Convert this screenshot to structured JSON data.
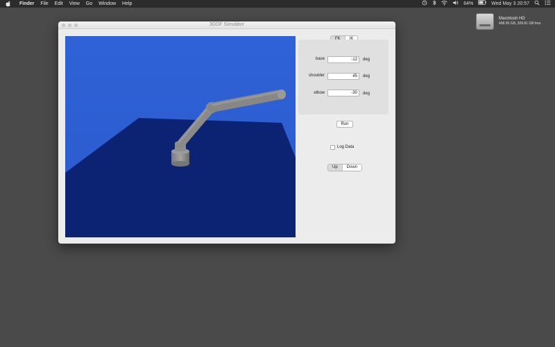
{
  "menubar": {
    "app": "Finder",
    "items": [
      "File",
      "Edit",
      "View",
      "Go",
      "Window",
      "Help"
    ],
    "battery": "64%",
    "datetime": "Wed May 3  20:57"
  },
  "desktop": {
    "disk_name": "Macintosh HD",
    "disk_info": "498.95 GB, 309.81 GB free"
  },
  "window": {
    "title": "3DOF Simulator"
  },
  "mode_tabs": [
    "FK",
    "IK"
  ],
  "joints": [
    {
      "label": "base",
      "value": "-12",
      "unit": "deg"
    },
    {
      "label": "shoulder",
      "value": "45",
      "unit": "deg"
    },
    {
      "label": "elbow",
      "value": "-30",
      "unit": "deg"
    }
  ],
  "run_label": "Run",
  "log_label": "Log Data",
  "log_checked": false,
  "view_tabs": [
    "Up",
    "Down"
  ],
  "colors": {
    "sky": "#2f63d4",
    "floor": "#0b2372",
    "arm": "#8c8c8c"
  }
}
